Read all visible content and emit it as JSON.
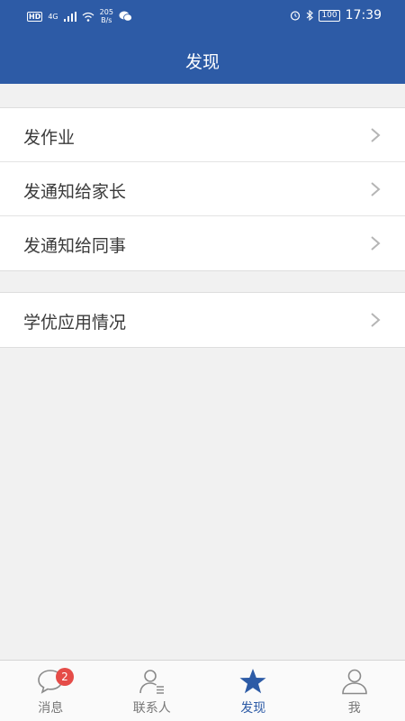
{
  "status_bar": {
    "hd": "HD",
    "network": "4G",
    "speed_value": "205",
    "speed_unit": "B/s",
    "battery": "100",
    "time": "17:39"
  },
  "header": {
    "title": "发现"
  },
  "menu_groups": [
    {
      "items": [
        {
          "label": "发作业"
        },
        {
          "label": "发通知给家长"
        },
        {
          "label": "发通知给同事"
        }
      ]
    },
    {
      "items": [
        {
          "label": "学优应用情况"
        }
      ]
    }
  ],
  "tabs": [
    {
      "label": "消息",
      "icon": "message-icon",
      "badge": "2"
    },
    {
      "label": "联系人",
      "icon": "contacts-icon"
    },
    {
      "label": "发现",
      "icon": "star-icon",
      "active": true
    },
    {
      "label": "我",
      "icon": "profile-icon"
    }
  ],
  "colors": {
    "primary": "#2d5ba6",
    "badge": "#e54c48",
    "background": "#f1f1f1"
  }
}
